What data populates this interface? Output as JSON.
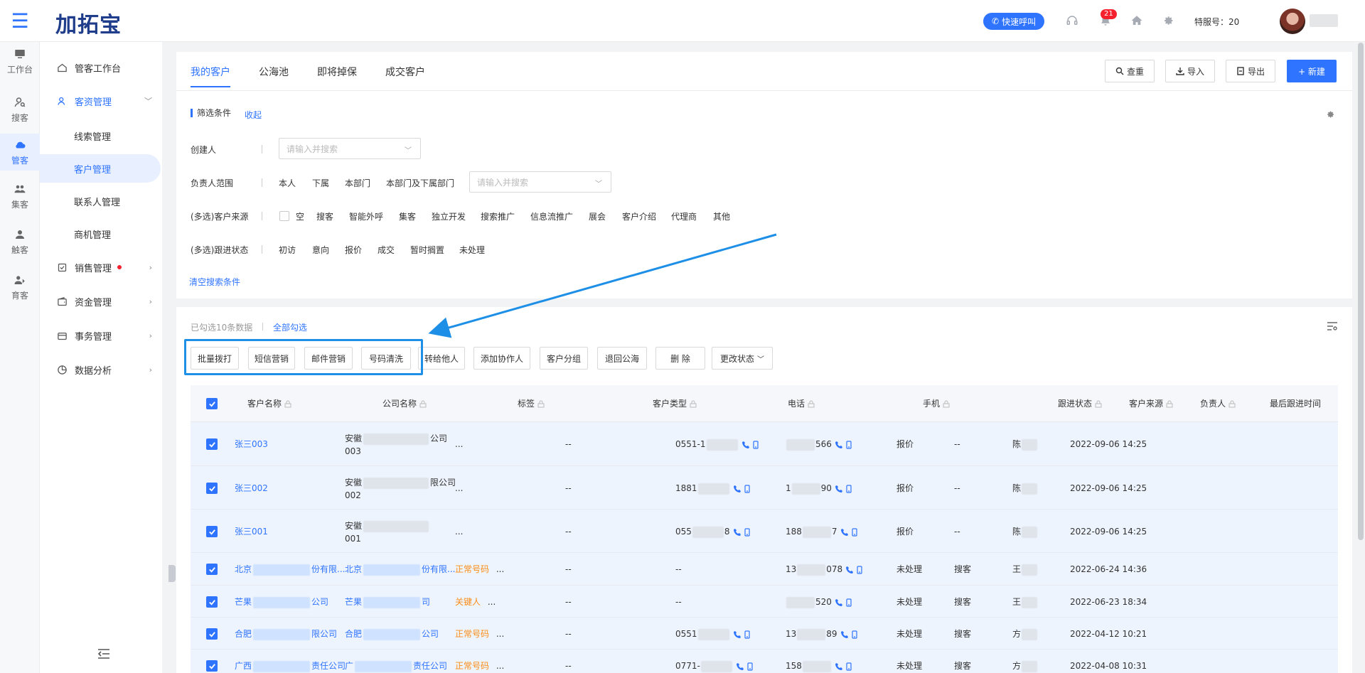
{
  "header": {
    "logo": "加拓宝",
    "quick_call": "快速呼叫",
    "notification_count": "21",
    "service_no_label": "特服号：20"
  },
  "rail": [
    {
      "label": "工作台",
      "icon": "monitor-icon"
    },
    {
      "label": "搜客",
      "icon": "search-user-icon"
    },
    {
      "label": "管客",
      "icon": "crm-cloud-icon",
      "active": true
    },
    {
      "label": "集客",
      "icon": "group-icon"
    },
    {
      "label": "触客",
      "icon": "contact-icon"
    },
    {
      "label": "育客",
      "icon": "nurture-icon"
    }
  ],
  "side": {
    "workbench": "管客工作台",
    "customer_mgmt": "客资管理",
    "sub": [
      "线索管理",
      "客户管理",
      "联系人管理",
      "商机管理"
    ],
    "sales": "销售管理",
    "funds": "资金管理",
    "affairs": "事务管理",
    "analysis": "数据分析"
  },
  "tabs": [
    "我的客户",
    "公海池",
    "即将掉保",
    "成交客户"
  ],
  "toolbar": {
    "dedupe": "查重",
    "import": "导入",
    "export": "导出",
    "create": "+ 新建"
  },
  "filters": {
    "title": "筛选条件",
    "collapse": "收起",
    "creator_label": "创建人",
    "creator_placeholder": "请输入并搜索",
    "owner_label": "负责人范围",
    "owner_options": [
      "本人",
      "下属",
      "本部门",
      "本部门及下属部门"
    ],
    "owner_placeholder": "请输入并搜索",
    "source_label": "(多选)客户来源",
    "source_options": [
      "空",
      "搜客",
      "智能外呼",
      "集客",
      "独立开发",
      "搜索推广",
      "信息流推广",
      "展会",
      "客户介绍",
      "代理商",
      "其他"
    ],
    "status_label": "(多选)跟进状态",
    "status_options": [
      "初访",
      "意向",
      "报价",
      "成交",
      "暂时搁置",
      "未处理"
    ],
    "clear": "清空搜索条件"
  },
  "selection": {
    "info": "已勾选10条数据",
    "select_all": "全部勾选"
  },
  "actions": [
    "批量拨打",
    "短信营销",
    "邮件营销",
    "号码清洗",
    "转给他人",
    "添加协作人",
    "客户分组",
    "退回公海",
    "删 除",
    "更改状态"
  ],
  "columns": [
    "客户名称",
    "公司名称",
    "标签",
    "客户类型",
    "电话",
    "手机",
    "跟进状态",
    "客户来源",
    "负责人",
    "最后跟进时间"
  ],
  "rows": [
    {
      "name": "张三003",
      "company_a": "安徽",
      "company_b": "公司",
      "company_c": "003",
      "tag": "...",
      "tag_more": "",
      "type": "--",
      "phone": "0551-1",
      "phone_b": "",
      "mobile_a": "",
      "mobile_b": "566",
      "status": "报价",
      "source": "--",
      "owner": "陈",
      "time": "2022-09-06 14:25"
    },
    {
      "name": "张三002",
      "company_a": "安徽",
      "company_b": "限公司",
      "company_c": "002",
      "tag": "...",
      "tag_more": "",
      "type": "--",
      "phone": "1881",
      "phone_b": "",
      "mobile_a": "1",
      "mobile_b": "90",
      "status": "报价",
      "source": "--",
      "owner": "陈",
      "time": "2022-09-06 14:25"
    },
    {
      "name": "张三001",
      "company_a": "安徽",
      "company_b": "",
      "company_c": "001",
      "tag": "...",
      "tag_more": "",
      "type": "--",
      "phone": "055",
      "phone_b": "8",
      "mobile_a": "188",
      "mobile_b": "7",
      "status": "报价",
      "source": "--",
      "owner": "陈",
      "time": "2022-09-06 14:25"
    },
    {
      "name": "北京",
      "name_b": "份有限...",
      "company_a": "北京",
      "company_b": "份有限...",
      "company_c": "",
      "tag": "正常号码",
      "tag_more": "...",
      "type": "--",
      "phone": "--",
      "phone_b": "",
      "mobile_a": "13",
      "mobile_b": "078",
      "status": "未处理",
      "source": "搜客",
      "owner": "王",
      "time": "2022-06-24 14:36"
    },
    {
      "name": "芒果",
      "name_b": "公司",
      "company_a": "芒果",
      "company_b": "司",
      "company_c": "",
      "tag": "关键人",
      "tag_more": "...",
      "type": "--",
      "phone": "--",
      "phone_b": "",
      "mobile_a": "",
      "mobile_b": "520",
      "status": "未处理",
      "source": "搜客",
      "owner": "王",
      "time": "2022-06-23 18:34"
    },
    {
      "name": "合肥",
      "name_b": "限公司",
      "company_a": "合肥",
      "company_b": "公司",
      "company_c": "",
      "tag": "正常号码",
      "tag_more": "...",
      "type": "--",
      "phone": "0551",
      "phone_b": "",
      "mobile_a": "13",
      "mobile_b": "89",
      "status": "未处理",
      "source": "搜客",
      "owner": "方",
      "time": "2022-04-12 10:21"
    },
    {
      "name": "广西",
      "name_b": "责任公司",
      "company_a": "广",
      "company_b": "责任公司",
      "company_c": "",
      "tag": "正常号码",
      "tag_more": "...",
      "type": "--",
      "phone": "0771-",
      "phone_b": "",
      "mobile_a": "158",
      "mobile_b": "",
      "status": "未处理",
      "source": "搜客",
      "owner": "方",
      "time": "2022-04-08 10:31"
    }
  ],
  "colors": {
    "primary": "#2f74ff",
    "highlight": "#1e8fe6",
    "tag": "#fa8c16",
    "badge": "#f5222d"
  }
}
